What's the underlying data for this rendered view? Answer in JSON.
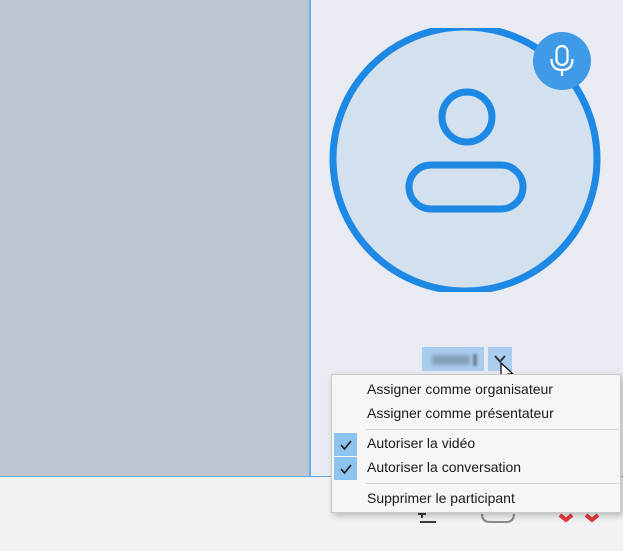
{
  "participant_panel": {
    "name_display": "",
    "avatar_icon": "user-icon",
    "mic_icon": "microphone-icon",
    "options_icon": "chevron-down-icon"
  },
  "context_menu": {
    "items": [
      {
        "label": "Assigner comme organisateur",
        "checked": false
      },
      {
        "label": "Assigner comme présentateur",
        "checked": false
      },
      {
        "label": "Autoriser la vidéo",
        "checked": true
      },
      {
        "label": "Autoriser la conversation",
        "checked": true
      },
      {
        "label": "Supprimer le participant",
        "checked": false
      }
    ]
  },
  "colors": {
    "accent": "#1e88e5",
    "mic_bg": "#3f9be6",
    "highlight": "#a9cdef",
    "check_bg": "#8fc3ef",
    "left_pane": "#bcc6d0",
    "right_pane": "#e8ebf1"
  }
}
